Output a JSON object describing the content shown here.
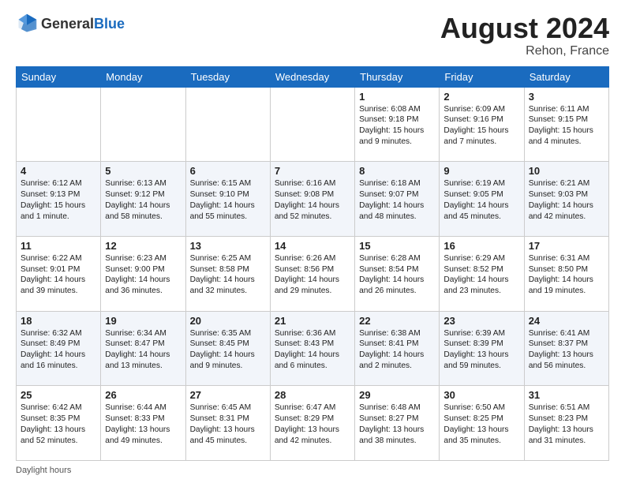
{
  "header": {
    "logo_general": "General",
    "logo_blue": "Blue",
    "month_year": "August 2024",
    "location": "Rehon, France"
  },
  "footer": {
    "daylight_label": "Daylight hours"
  },
  "weekdays": [
    "Sunday",
    "Monday",
    "Tuesday",
    "Wednesday",
    "Thursday",
    "Friday",
    "Saturday"
  ],
  "weeks": [
    [
      {
        "day": "",
        "info": ""
      },
      {
        "day": "",
        "info": ""
      },
      {
        "day": "",
        "info": ""
      },
      {
        "day": "",
        "info": ""
      },
      {
        "day": "1",
        "info": "Sunrise: 6:08 AM\nSunset: 9:18 PM\nDaylight: 15 hours\nand 9 minutes."
      },
      {
        "day": "2",
        "info": "Sunrise: 6:09 AM\nSunset: 9:16 PM\nDaylight: 15 hours\nand 7 minutes."
      },
      {
        "day": "3",
        "info": "Sunrise: 6:11 AM\nSunset: 9:15 PM\nDaylight: 15 hours\nand 4 minutes."
      }
    ],
    [
      {
        "day": "4",
        "info": "Sunrise: 6:12 AM\nSunset: 9:13 PM\nDaylight: 15 hours\nand 1 minute."
      },
      {
        "day": "5",
        "info": "Sunrise: 6:13 AM\nSunset: 9:12 PM\nDaylight: 14 hours\nand 58 minutes."
      },
      {
        "day": "6",
        "info": "Sunrise: 6:15 AM\nSunset: 9:10 PM\nDaylight: 14 hours\nand 55 minutes."
      },
      {
        "day": "7",
        "info": "Sunrise: 6:16 AM\nSunset: 9:08 PM\nDaylight: 14 hours\nand 52 minutes."
      },
      {
        "day": "8",
        "info": "Sunrise: 6:18 AM\nSunset: 9:07 PM\nDaylight: 14 hours\nand 48 minutes."
      },
      {
        "day": "9",
        "info": "Sunrise: 6:19 AM\nSunset: 9:05 PM\nDaylight: 14 hours\nand 45 minutes."
      },
      {
        "day": "10",
        "info": "Sunrise: 6:21 AM\nSunset: 9:03 PM\nDaylight: 14 hours\nand 42 minutes."
      }
    ],
    [
      {
        "day": "11",
        "info": "Sunrise: 6:22 AM\nSunset: 9:01 PM\nDaylight: 14 hours\nand 39 minutes."
      },
      {
        "day": "12",
        "info": "Sunrise: 6:23 AM\nSunset: 9:00 PM\nDaylight: 14 hours\nand 36 minutes."
      },
      {
        "day": "13",
        "info": "Sunrise: 6:25 AM\nSunset: 8:58 PM\nDaylight: 14 hours\nand 32 minutes."
      },
      {
        "day": "14",
        "info": "Sunrise: 6:26 AM\nSunset: 8:56 PM\nDaylight: 14 hours\nand 29 minutes."
      },
      {
        "day": "15",
        "info": "Sunrise: 6:28 AM\nSunset: 8:54 PM\nDaylight: 14 hours\nand 26 minutes."
      },
      {
        "day": "16",
        "info": "Sunrise: 6:29 AM\nSunset: 8:52 PM\nDaylight: 14 hours\nand 23 minutes."
      },
      {
        "day": "17",
        "info": "Sunrise: 6:31 AM\nSunset: 8:50 PM\nDaylight: 14 hours\nand 19 minutes."
      }
    ],
    [
      {
        "day": "18",
        "info": "Sunrise: 6:32 AM\nSunset: 8:49 PM\nDaylight: 14 hours\nand 16 minutes."
      },
      {
        "day": "19",
        "info": "Sunrise: 6:34 AM\nSunset: 8:47 PM\nDaylight: 14 hours\nand 13 minutes."
      },
      {
        "day": "20",
        "info": "Sunrise: 6:35 AM\nSunset: 8:45 PM\nDaylight: 14 hours\nand 9 minutes."
      },
      {
        "day": "21",
        "info": "Sunrise: 6:36 AM\nSunset: 8:43 PM\nDaylight: 14 hours\nand 6 minutes."
      },
      {
        "day": "22",
        "info": "Sunrise: 6:38 AM\nSunset: 8:41 PM\nDaylight: 14 hours\nand 2 minutes."
      },
      {
        "day": "23",
        "info": "Sunrise: 6:39 AM\nSunset: 8:39 PM\nDaylight: 13 hours\nand 59 minutes."
      },
      {
        "day": "24",
        "info": "Sunrise: 6:41 AM\nSunset: 8:37 PM\nDaylight: 13 hours\nand 56 minutes."
      }
    ],
    [
      {
        "day": "25",
        "info": "Sunrise: 6:42 AM\nSunset: 8:35 PM\nDaylight: 13 hours\nand 52 minutes."
      },
      {
        "day": "26",
        "info": "Sunrise: 6:44 AM\nSunset: 8:33 PM\nDaylight: 13 hours\nand 49 minutes."
      },
      {
        "day": "27",
        "info": "Sunrise: 6:45 AM\nSunset: 8:31 PM\nDaylight: 13 hours\nand 45 minutes."
      },
      {
        "day": "28",
        "info": "Sunrise: 6:47 AM\nSunset: 8:29 PM\nDaylight: 13 hours\nand 42 minutes."
      },
      {
        "day": "29",
        "info": "Sunrise: 6:48 AM\nSunset: 8:27 PM\nDaylight: 13 hours\nand 38 minutes."
      },
      {
        "day": "30",
        "info": "Sunrise: 6:50 AM\nSunset: 8:25 PM\nDaylight: 13 hours\nand 35 minutes."
      },
      {
        "day": "31",
        "info": "Sunrise: 6:51 AM\nSunset: 8:23 PM\nDaylight: 13 hours\nand 31 minutes."
      }
    ]
  ]
}
